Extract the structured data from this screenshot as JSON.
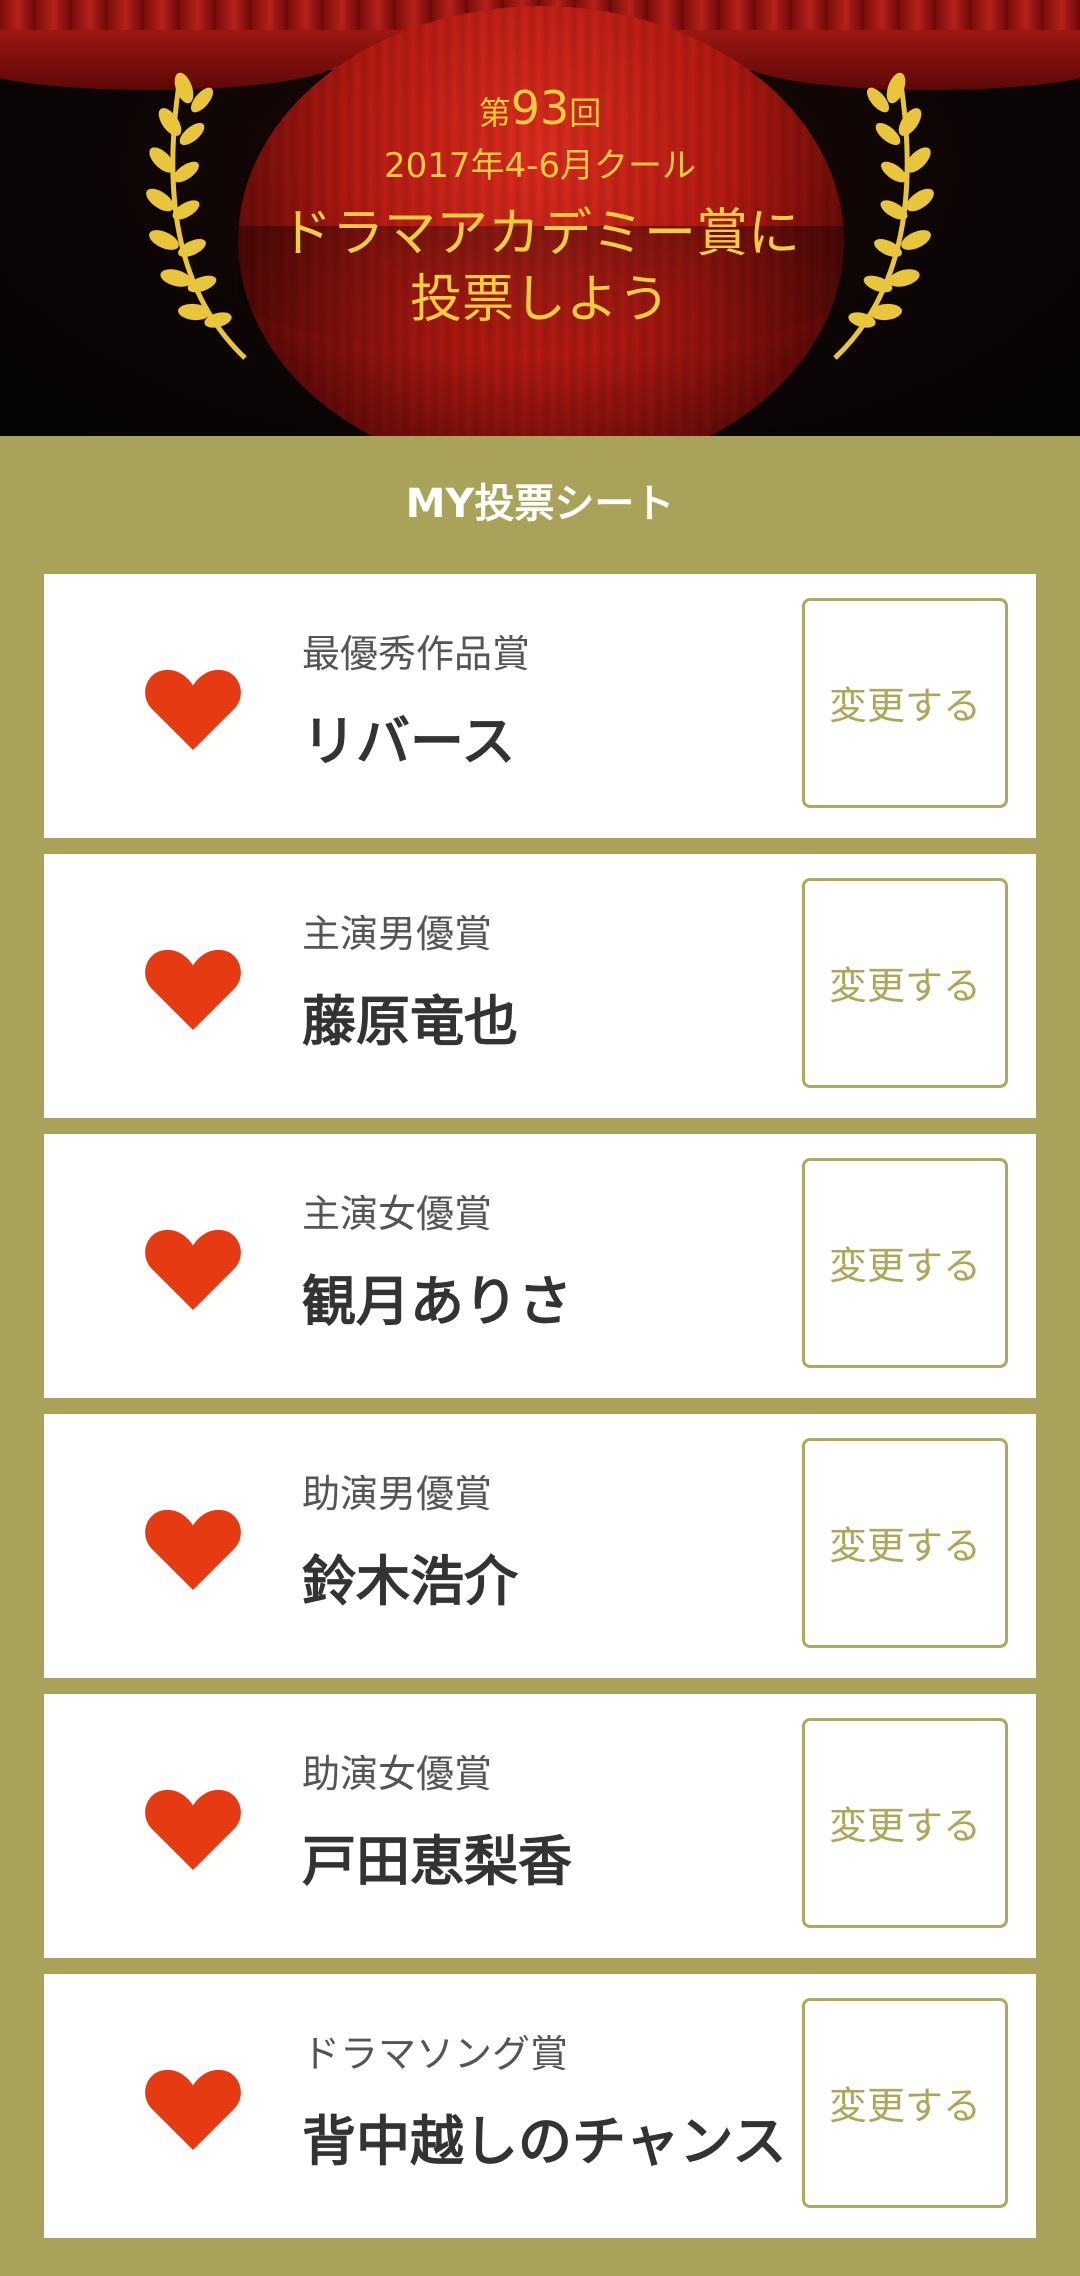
{
  "hero": {
    "edition_prefix": "第",
    "edition_number": "93",
    "edition_suffix": "回",
    "season": "2017年4-6月クール",
    "headline_line1": "ドラマアカデミー賞に",
    "headline_line2": "投票しよう"
  },
  "sheet": {
    "title": "MY投票シート",
    "change_label": "変更する",
    "items": [
      {
        "category": "最優秀作品賞",
        "name": "リバース"
      },
      {
        "category": "主演男優賞",
        "name": "藤原竜也"
      },
      {
        "category": "主演女優賞",
        "name": "観月ありさ"
      },
      {
        "category": "助演男優賞",
        "name": "鈴木浩介"
      },
      {
        "category": "助演女優賞",
        "name": "戸田恵梨香"
      },
      {
        "category": "ドラマソング賞",
        "name": "背中越しのチャンス"
      }
    ]
  },
  "colors": {
    "background": "#a9a359",
    "heart": "#e53a12",
    "accent_gold": "#f0cc3f",
    "button_text": "#aea657"
  },
  "icons": {
    "vote": "heart-icon",
    "decoration": "laurel-wreath-icon"
  }
}
